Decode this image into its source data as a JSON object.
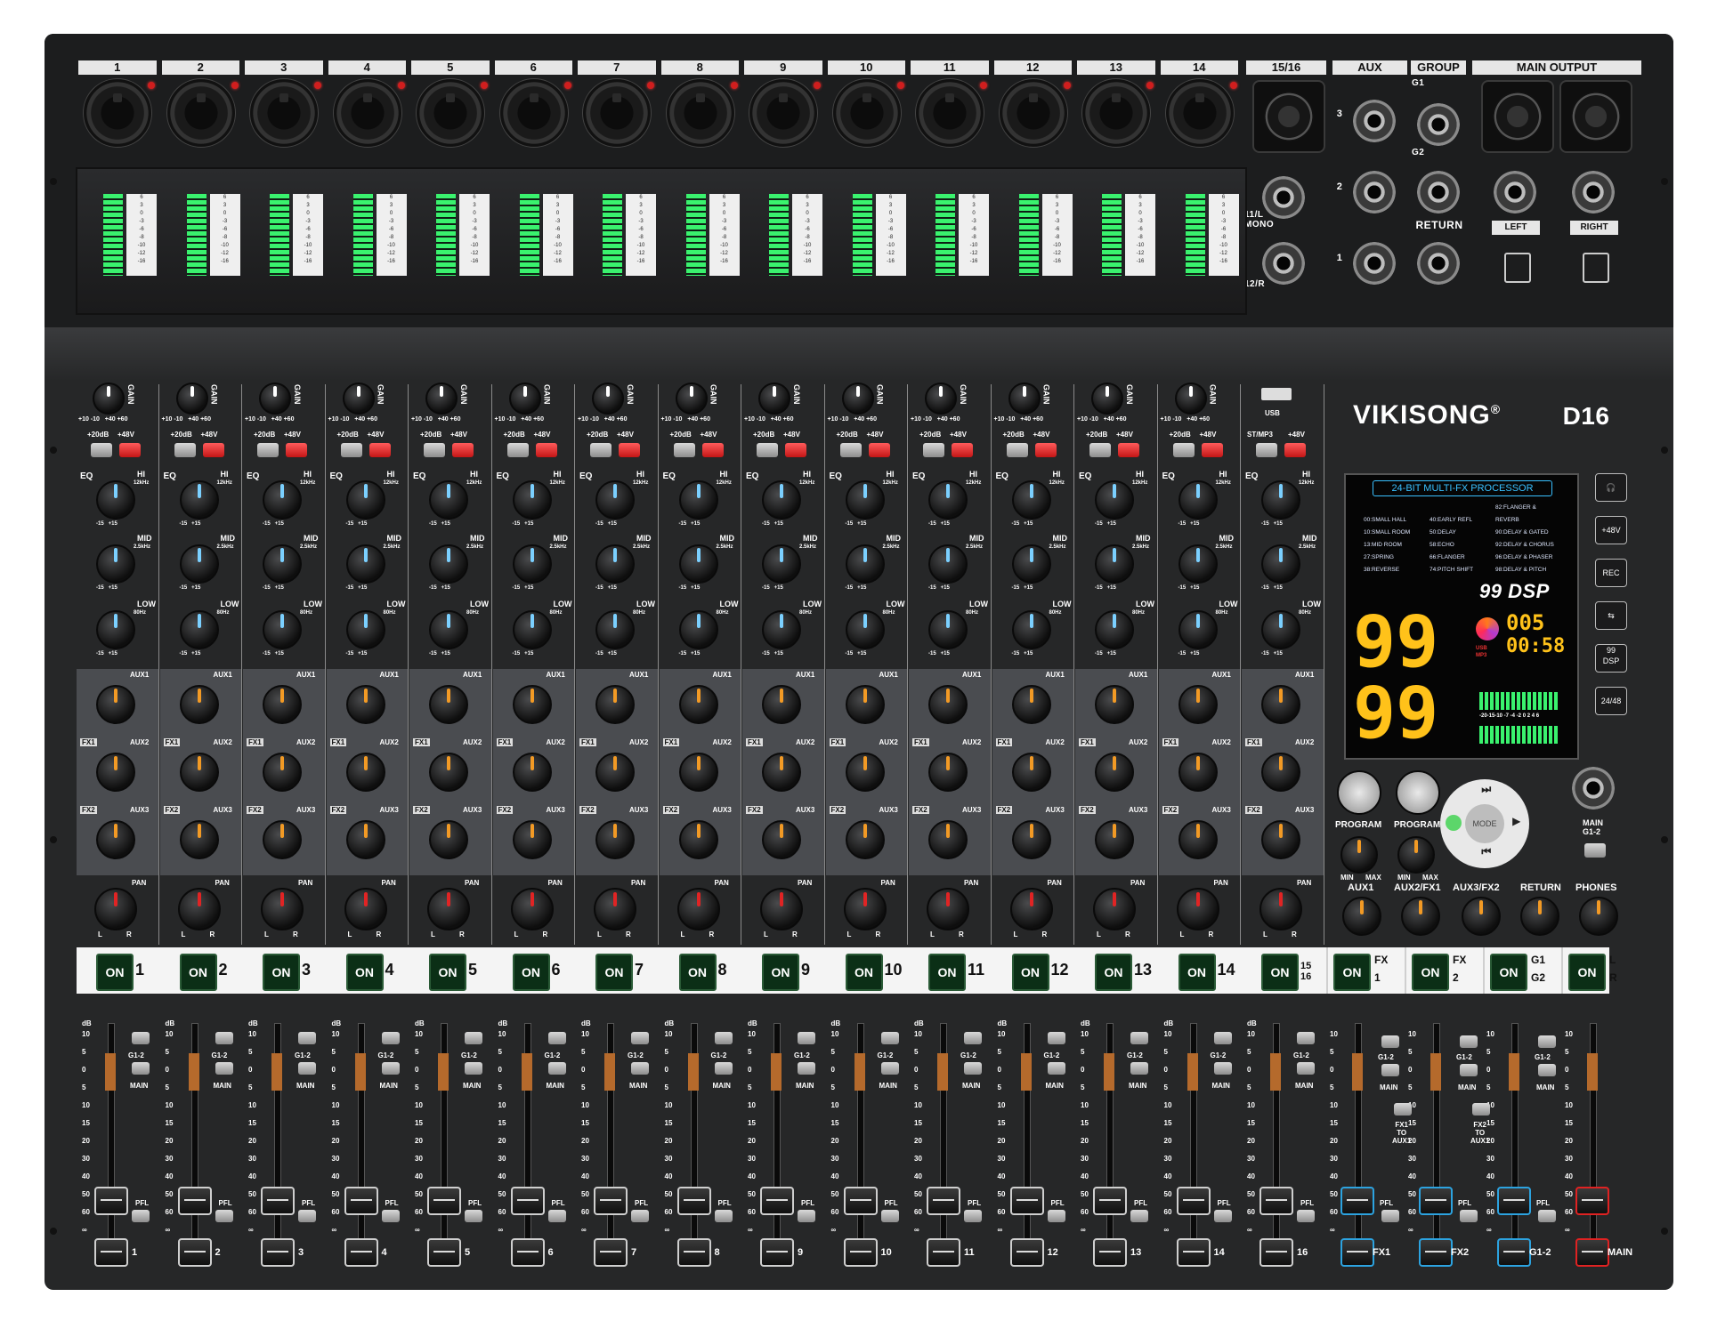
{
  "brand": {
    "name": "VIKISONG",
    "reg": "®",
    "model": "D16"
  },
  "inputs": {
    "channel_labels": [
      "1",
      "2",
      "3",
      "4",
      "5",
      "6",
      "7",
      "8",
      "9",
      "10",
      "11",
      "12",
      "13",
      "14"
    ],
    "stereo_label": "15/16",
    "aux_header": "AUX",
    "group_header": "GROUP",
    "main_output_header": "MAIN OUTPUT",
    "aux_numbers": [
      "3",
      "2",
      "1"
    ],
    "mono_left": "11/L\nMONO",
    "mono_right": "12/R",
    "g1": "G1",
    "g2": "G2",
    "return": "RETURN",
    "left": "LEFT",
    "right": "RIGHT"
  },
  "meter_scale": [
    "6",
    "3",
    "0",
    "-3",
    "-6",
    "-8",
    "-10",
    "-12",
    "-16"
  ],
  "strip": {
    "gain": "GAIN",
    "gain_marks": "+10 -10   +40 +60",
    "pad": "+20dB",
    "phantom": "+48V",
    "stereo_sel": "ST/MP3",
    "usb": "USB",
    "eq": "EQ",
    "hi": "HI",
    "hi_freq": "12kHz",
    "mid": "MID",
    "mid_freq": "2.5kHz",
    "low": "LOW",
    "low_freq": "80Hz",
    "eq_range": "-15   +15",
    "aux1": "AUX1",
    "aux2": "AUX2",
    "aux3": "AUX3",
    "fx1": "FX1",
    "fx2": "FX2",
    "pan": "PAN",
    "pan_l": "L",
    "pan_r": "R",
    "on": "ON",
    "g12": "G1-2",
    "main": "MAIN",
    "pfl": "PFL",
    "db": "dB"
  },
  "fader_scale": [
    "10",
    "5",
    "0",
    "5",
    "10",
    "15",
    "20",
    "30",
    "40",
    "50",
    "60",
    "∞"
  ],
  "on_channels": [
    "1",
    "2",
    "3",
    "4",
    "5",
    "6",
    "7",
    "8",
    "9",
    "10",
    "11",
    "12",
    "13",
    "14",
    "15\n16"
  ],
  "master_on": [
    {
      "top": "FX",
      "bottom": "1"
    },
    {
      "top": "FX",
      "bottom": "2"
    },
    {
      "top": "G1",
      "bottom": "G2"
    },
    {
      "top": "L",
      "bottom": "R"
    }
  ],
  "bottom_labels": [
    "1",
    "2",
    "3",
    "4",
    "5",
    "6",
    "7",
    "8",
    "9",
    "10",
    "11",
    "12",
    "13",
    "14",
    "16",
    "FX1",
    "FX2",
    "G1-2",
    "MAIN"
  ],
  "dsp": {
    "title": "24-BIT MULTI-FX PROCESSOR",
    "effects": [
      "00:SMALL HALL",
      "40:EARLY REFL",
      "82:FLANGER & REVERB",
      "10:SMALL ROOM",
      "50:DELAY",
      "90:DELAY & GATED",
      "13:MID ROOM",
      "58:ECHO",
      "92:DELAY & CHORUS",
      "27:SPRING",
      "66:FLANGER",
      "96:DELAY & PHASER",
      "38:REVERSE",
      "74:PITCH SHIFT",
      "98:DELAY & PITCH"
    ],
    "badge": "99 DSP",
    "display1": "99",
    "display2": "99",
    "track": "005",
    "time": "00:58",
    "usb_lbl": "USB",
    "mp3_lbl": "MP3",
    "level_scale": "-20-15-10 -7 -4 -2 0 2 4 6"
  },
  "master": {
    "program": "PROGRAM",
    "min": "MIN",
    "max": "MAX",
    "aux1": "AUX1",
    "aux2fx1": "AUX2/FX1",
    "aux3fx2": "AUX3/FX2",
    "return": "RETURN",
    "phones": "PHONES",
    "main_g12": "MAIN\nG1-2",
    "mode": "MODE",
    "fx1_to_aux1": "FX1\nTO\nAUX1",
    "fx2_to_aux1": "FX2\nTO\nAUX1"
  },
  "side_icons": [
    "+48V",
    "REC",
    "99\nDSP",
    "24/48"
  ]
}
